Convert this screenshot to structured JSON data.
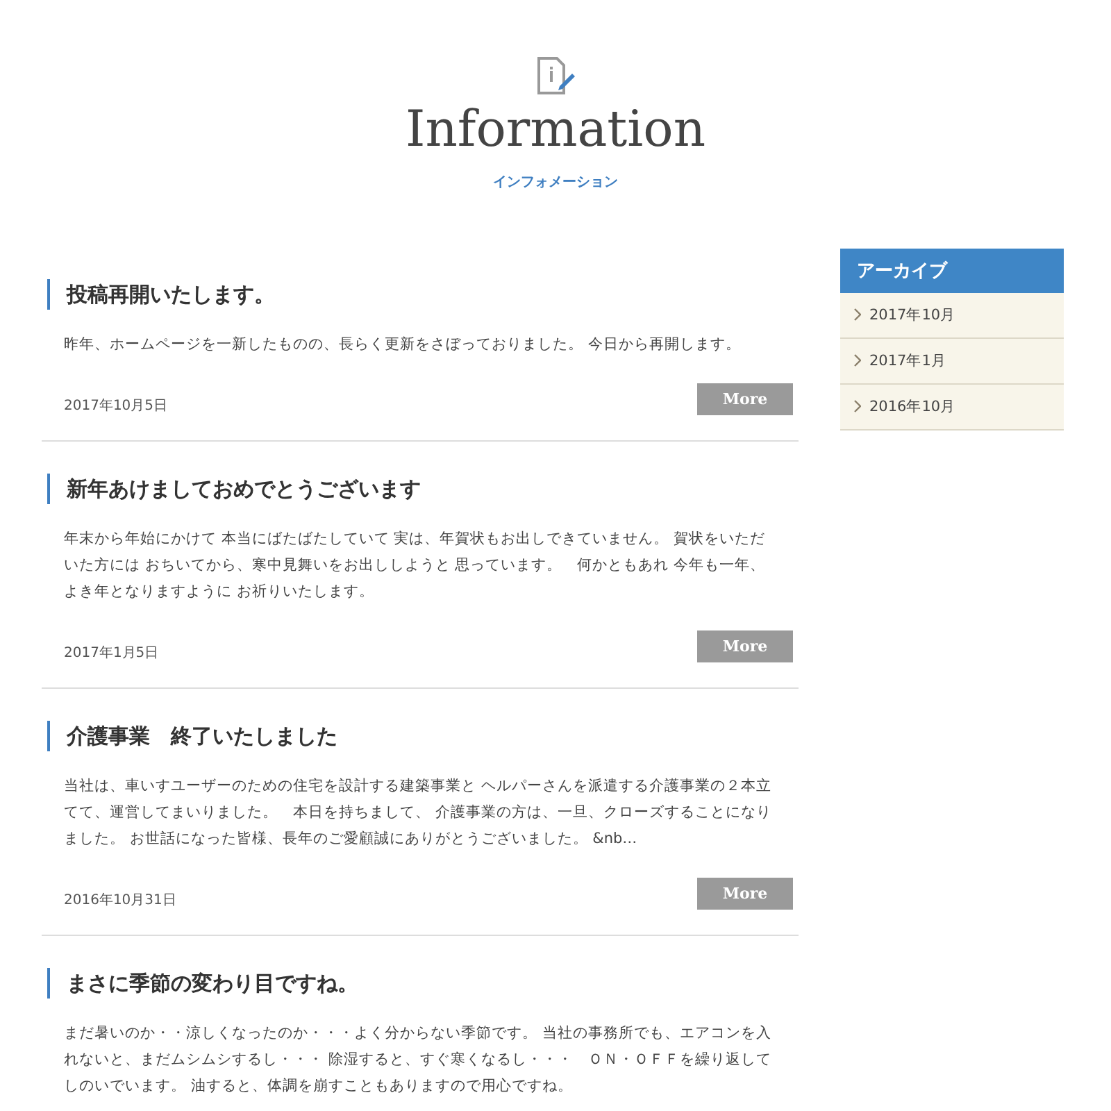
{
  "header": {
    "title": "Information",
    "subtitle": "インフォメーション"
  },
  "posts": [
    {
      "title": "投稿再開いたします。",
      "body": "昨年、ホームページを一新したものの、長らく更新をさぼっておりました。 今日から再開します。",
      "date": "2017年10月5日",
      "button": "More"
    },
    {
      "title": "新年あけましておめでとうございます",
      "body": "年末から年始にかけて 本当にばたばたしていて 実は、年賀状もお出しできていません。 賀状をいただいた方には おちいてから、寒中見舞いをお出ししようと 思っています。　何かともあれ 今年も一年、よき年となりますように お祈りいたします。",
      "date": "2017年1月5日",
      "button": "More"
    },
    {
      "title": "介護事業　終了いたしました",
      "body": "当社は、車いすユーザーのための住宅を設計する建築事業と ヘルパーさんを派遣する介護事業の２本立てて、運営してまいりました。　本日を持ちまして、 介護事業の方は、一旦、クローズすることになりました。 お世話になった皆様、長年のご愛顧誠にありがとうございました。 &nb…",
      "date": "2016年10月31日",
      "button": "More"
    },
    {
      "title": "まさに季節の変わり目ですね。",
      "body": "まだ暑いのか・・涼しくなったのか・・・よく分からない季節です。 当社の事務所でも、エアコンを入れないと、まだムシムシするし・・・ 除湿すると、すぐ寒くなるし・・・　ＯＮ・ＯＦＦを繰り返してしのいでいます。 油すると、体調を崩すこともありますので用心ですね。"
    }
  ],
  "sidebar": {
    "heading": "アーカイブ",
    "items": [
      "2017年10月",
      "2017年1月",
      "2016年10月"
    ]
  }
}
